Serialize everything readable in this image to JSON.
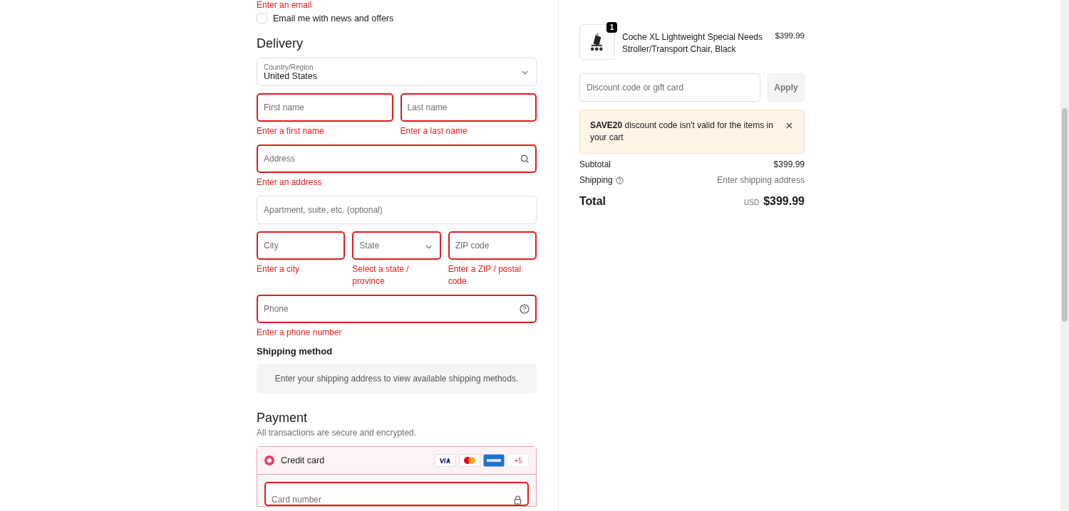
{
  "contact": {
    "error": "Enter an email",
    "newsletter": {
      "label": "Email me with news and offers",
      "checked": false
    }
  },
  "delivery": {
    "heading": "Delivery",
    "country": {
      "label": "Country/Region",
      "value": "United States"
    },
    "rows": [
      [
        {
          "kind": "text",
          "placeholder": "First name",
          "invalid": true,
          "error": "Enter a first name"
        },
        {
          "kind": "text",
          "placeholder": "Last name",
          "invalid": true,
          "error": "Enter a last name"
        }
      ],
      [
        {
          "kind": "search",
          "placeholder": "Address",
          "invalid": true,
          "error": "Enter an address"
        }
      ],
      [
        {
          "kind": "text",
          "placeholder": "Apartment, suite, etc. (optional)",
          "invalid": false
        }
      ],
      [
        {
          "kind": "text",
          "placeholder": "City",
          "invalid": true,
          "error": "Enter a city"
        },
        {
          "kind": "select",
          "placeholder": "State",
          "invalid": true,
          "error": "Select a state / province"
        },
        {
          "kind": "text",
          "placeholder": "ZIP code",
          "invalid": true,
          "error": "Enter a ZIP / postal code"
        }
      ],
      [
        {
          "kind": "help",
          "placeholder": "Phone",
          "invalid": true,
          "error": "Enter a phone number"
        }
      ]
    ]
  },
  "shipping_method": {
    "heading": "Shipping method",
    "notice": "Enter your shipping address to view available shipping methods."
  },
  "payment": {
    "heading": "Payment",
    "subtitle": "All transactions are secure and encrypted.",
    "method": {
      "label": "Credit card",
      "selected": true,
      "more_cards": "+5"
    },
    "card_number": {
      "placeholder": "Card number",
      "invalid": true
    }
  },
  "summary": {
    "item": {
      "quantity": "1",
      "name": "Coche XL Lightweight Special Needs Stroller/Transport Chair, Black",
      "price": "$399.99"
    },
    "discount": {
      "placeholder": "Discount code or gift card",
      "button": "Apply"
    },
    "alert": {
      "code": "SAVE20",
      "message": " discount code isn't valid for the items in your cart"
    },
    "subtotal": {
      "label": "Subtotal",
      "value": "$399.99"
    },
    "shipping": {
      "label": "Shipping",
      "value": "Enter shipping address"
    },
    "total": {
      "label": "Total",
      "currency": "USD",
      "value": "$399.99"
    }
  }
}
